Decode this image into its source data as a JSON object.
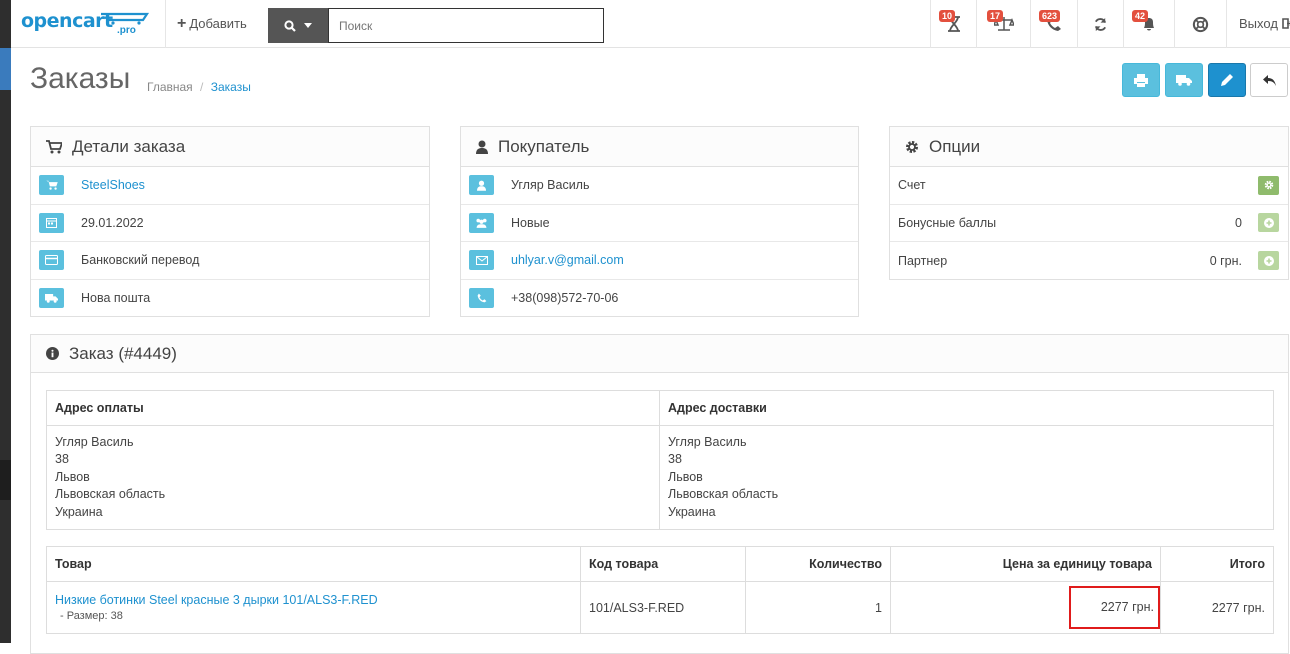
{
  "header": {
    "logo_text": "opencart",
    "logo_suffix": ".pro",
    "add_label": "Добавить",
    "search_placeholder": "Поиск",
    "badges": {
      "hourglass": "10",
      "scale": "17",
      "phone": "623",
      "bell": "42"
    },
    "logout_label": "Выход"
  },
  "page": {
    "title": "Заказы",
    "breadcrumb": [
      "Главная",
      "Заказы"
    ]
  },
  "order_details": {
    "title": "Детали заказа",
    "store": "SteelShoes",
    "date": "29.01.2022",
    "payment": "Банковский перевод",
    "shipping": "Нова пошта"
  },
  "customer": {
    "title": "Покупатель",
    "name": "Угляр Василь",
    "group": "Новые",
    "email": "uhlyar.v@gmail.com",
    "phone": "+38(098)572-70-06"
  },
  "options": {
    "title": "Опции",
    "invoice_label": "Счет",
    "reward_label": "Бонусные баллы",
    "reward_value": "0",
    "affiliate_label": "Партнер",
    "affiliate_value": "0 грн."
  },
  "order": {
    "title": "Заказ (#4449)",
    "payment_address_header": "Адрес оплаты",
    "shipping_address_header": "Адрес доставки",
    "payment_address": [
      "Угляр Василь",
      "38",
      "Львов",
      "Львовская область",
      "Украина"
    ],
    "shipping_address": [
      "Угляр Василь",
      "38",
      "Львов",
      "Львовская область",
      "Украина"
    ],
    "columns": [
      "Товар",
      "Код товара",
      "Количество",
      "Цена за единицу товара",
      "Итого"
    ],
    "products": [
      {
        "name": "Низкие ботинки Steel красные 3 дырки 101/ALS3-F.RED",
        "option": "- Размер: 38",
        "model": "101/ALS3-F.RED",
        "quantity": "1",
        "price": "2277 грн.",
        "total": "2277 грн."
      }
    ]
  },
  "colors": {
    "accent": "#1e91cf",
    "info": "#5bc0de",
    "badge": "#e3503e",
    "success": "#8fbb6c",
    "highlight": "#e01b1b"
  }
}
